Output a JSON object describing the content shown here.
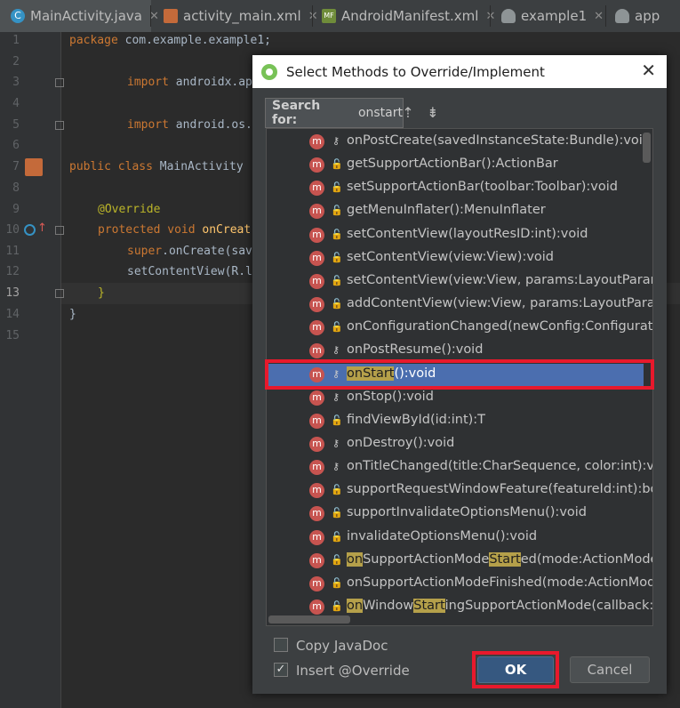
{
  "tabs": [
    {
      "label": "MainActivity.java",
      "icon": "java-class-icon"
    },
    {
      "label": "activity_main.xml",
      "icon": "layout-xml-icon"
    },
    {
      "label": "AndroidManifest.xml",
      "icon": "manifest-icon"
    },
    {
      "label": "example1",
      "icon": "gradle-icon"
    },
    {
      "label": "app",
      "icon": "gradle-icon"
    }
  ],
  "close_glyph": "✕",
  "editor": {
    "line_numbers": [
      "1",
      "2",
      "3",
      "4",
      "5",
      "6",
      "7",
      "8",
      "9",
      "10",
      "11",
      "12",
      "13",
      "14",
      "15"
    ],
    "code": {
      "l1_kw": "package",
      "l1_rest": " com.example.example1;",
      "l3_kw": "import",
      "l3_rest": " androidx.ap",
      "l5_kw": "import",
      "l5_rest": " android.os.",
      "l7_kw": "public class",
      "l7_rest": " MainActivity",
      "l9_ann": "@Override",
      "l10_kw": "protected void",
      "l10_fn": " onCreat",
      "l11_kw": "super",
      "l11_rest": ".onCreate(sav",
      "l12_rest": "setContentView(R.l",
      "l13_brace": "}",
      "l14_brace": "}"
    }
  },
  "dialog": {
    "title": "Select Methods to Override/Implement",
    "search_label": "Search for:",
    "search_value": "onstart",
    "methods": [
      {
        "name": "onPostCreate(savedInstanceState:Bundle):void",
        "vis": "protected"
      },
      {
        "name": "getSupportActionBar():ActionBar",
        "vis": "public"
      },
      {
        "name": "setSupportActionBar(toolbar:Toolbar):void",
        "vis": "public"
      },
      {
        "name": "getMenuInflater():MenuInflater",
        "vis": "public"
      },
      {
        "name": "setContentView(layoutResID:int):void",
        "vis": "public"
      },
      {
        "name": "setContentView(view:View):void",
        "vis": "public"
      },
      {
        "name": "setContentView(view:View, params:LayoutParams):",
        "vis": "public"
      },
      {
        "name": "addContentView(view:View, params:LayoutParams)",
        "vis": "public"
      },
      {
        "name": "onConfigurationChanged(newConfig:Configuratio",
        "vis": "public"
      },
      {
        "name": "onPostResume():void",
        "vis": "protected"
      },
      {
        "name": "onStart():void",
        "vis": "protected",
        "selected": true
      },
      {
        "name": "onStop():void",
        "vis": "protected"
      },
      {
        "name": "findViewById(id:int):T",
        "vis": "public"
      },
      {
        "name": "onDestroy():void",
        "vis": "protected"
      },
      {
        "name": "onTitleChanged(title:CharSequence, color:int):void",
        "vis": "protected"
      },
      {
        "name": "supportRequestWindowFeature(featureId:int):boole",
        "vis": "public"
      },
      {
        "name": "supportInvalidateOptionsMenu():void",
        "vis": "public"
      },
      {
        "name": "invalidateOptionsMenu():void",
        "vis": "public"
      },
      {
        "name": "onSupportActionModeStarted(mode:ActionMode):",
        "vis": "public"
      },
      {
        "name": "onSupportActionModeFinished(mode:ActionMode",
        "vis": "public"
      },
      {
        "name": "onWindowStartingSupportActionMode(callback:Ca",
        "vis": "public"
      }
    ],
    "copy_javadoc": {
      "label": "Copy JavaDoc",
      "checked": false
    },
    "insert_override": {
      "label": "Insert @Override",
      "checked": true
    },
    "ok_label": "OK",
    "cancel_label": "Cancel"
  },
  "colors": {
    "highlight_box": "#e8192c",
    "selection": "#4b6eaf",
    "search_match": "#b5a04a"
  }
}
